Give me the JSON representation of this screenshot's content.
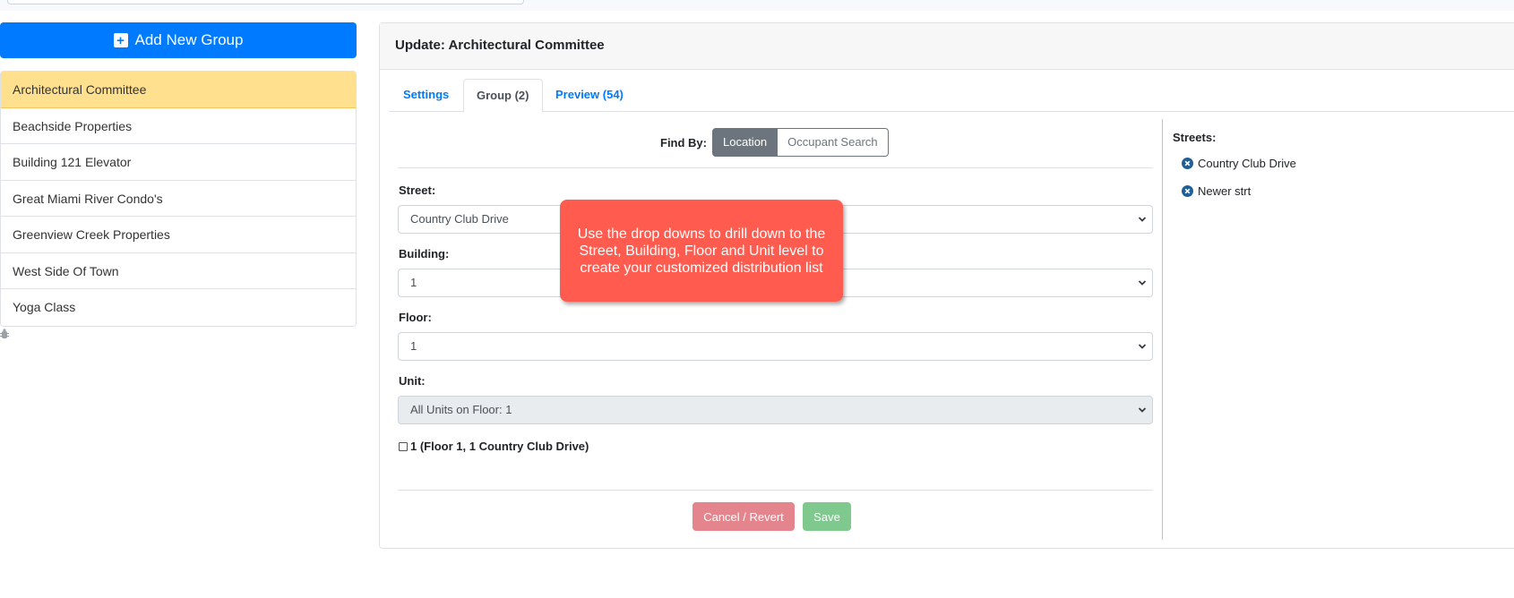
{
  "sidebar": {
    "add_button_label": "Add New Group",
    "groups": [
      {
        "label": "Architectural Committee",
        "active": true
      },
      {
        "label": "Beachside Properties"
      },
      {
        "label": "Building 121 Elevator"
      },
      {
        "label": "Great Miami River Condo's"
      },
      {
        "label": "Greenview Creek Properties"
      },
      {
        "label": "West Side Of Town"
      },
      {
        "label": "Yoga Class"
      }
    ]
  },
  "card": {
    "title": "Update: Architectural Committee",
    "tabs": [
      {
        "label": "Settings"
      },
      {
        "label": "Group (2)",
        "active": true
      },
      {
        "label": "Preview (54)"
      }
    ]
  },
  "find_by": {
    "label": "Find By:",
    "options": [
      "Location",
      "Occupant Search"
    ],
    "selected": "Location"
  },
  "fields": {
    "street": {
      "label": "Street:",
      "value": "Country Club Drive"
    },
    "building": {
      "label": "Building:",
      "value": "1"
    },
    "floor": {
      "label": "Floor:",
      "value": "1"
    },
    "unit": {
      "label": "Unit:",
      "value": "All Units on Floor: 1"
    }
  },
  "unit_checkbox_label": "1 (Floor 1, 1 Country Club Drive)",
  "actions": {
    "cancel_label": "Cancel / Revert",
    "save_label": "Save"
  },
  "streets_panel": {
    "title": "Streets:",
    "items": [
      "Country Club Drive",
      "Newer strt"
    ]
  },
  "tooltip_text": "Use the drop downs to drill down to the Street, Building, Floor and Unit level to create your customized distribution list",
  "colors": {
    "primary": "#007bff",
    "active_item": "#ffe08e",
    "tooltip": "#ff5b4f",
    "cancel": "#e4848d",
    "save": "#7fc98e",
    "secondary": "#6c757d"
  },
  "icons": {
    "add": "plus-square-icon",
    "remove_street": "times-circle-icon",
    "select_caret": "chevron-down-icon",
    "debug": "bug-icon"
  }
}
